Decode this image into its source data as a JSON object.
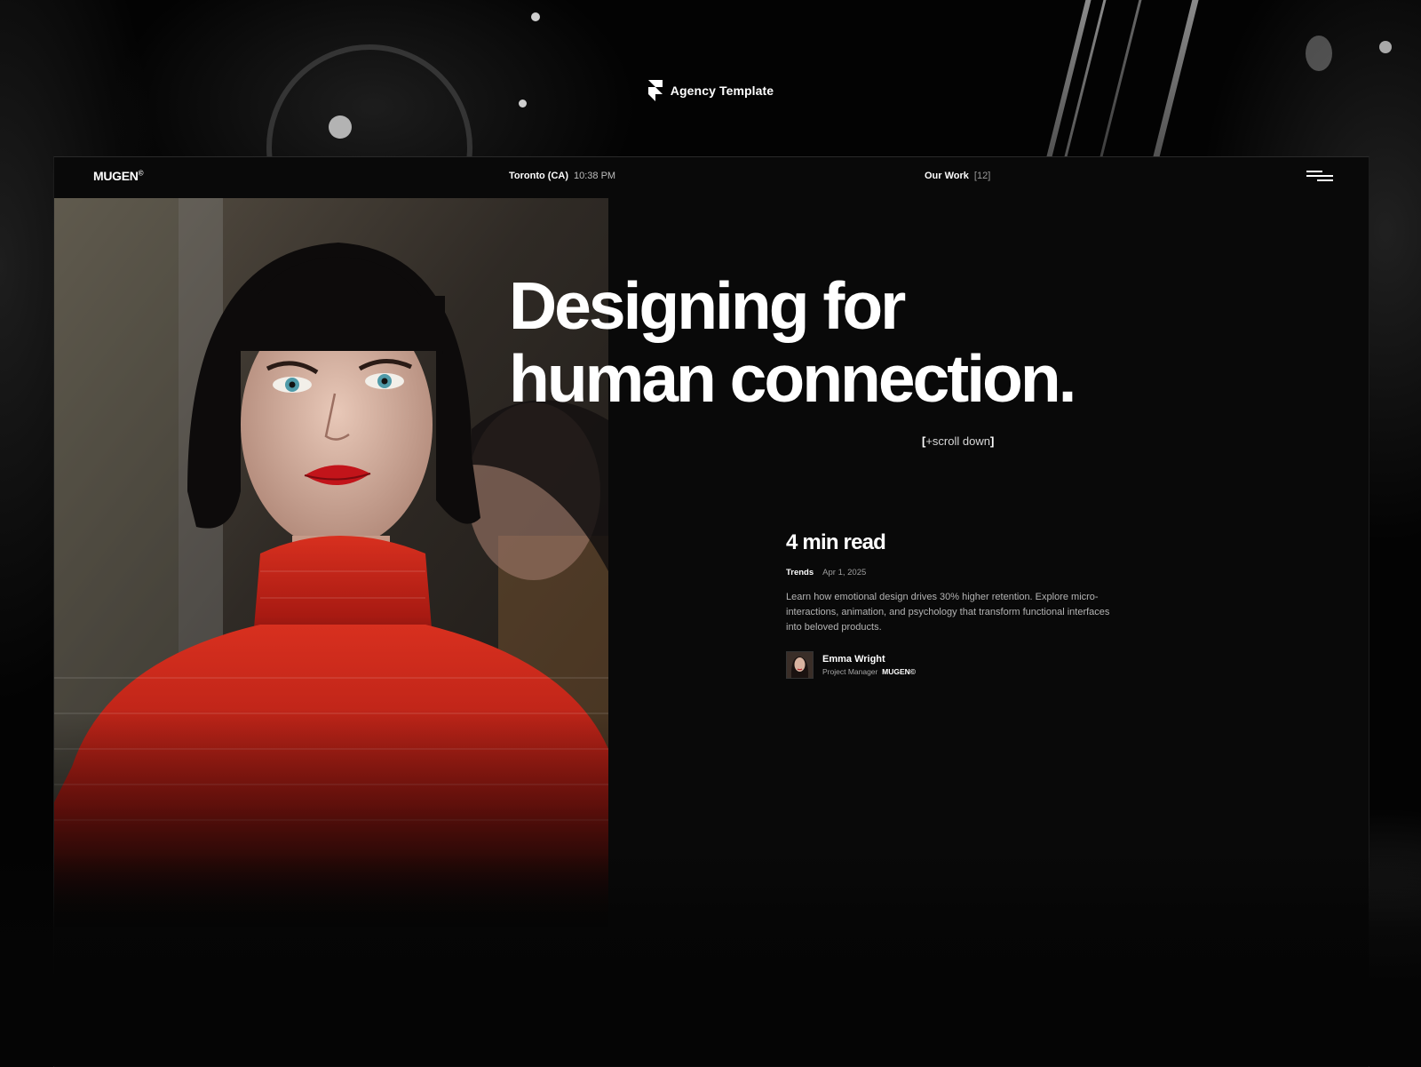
{
  "brand": {
    "title": "Agency Template",
    "logo_icon": "framer-logo-icon"
  },
  "site": {
    "logo": "MUGEN",
    "logo_mark": "©",
    "location": {
      "city": "Toronto (CA)",
      "time": "10:38 PM"
    },
    "nav_work": {
      "label": "Our Work",
      "count": "[12]"
    },
    "menu_icon": "hamburger-menu-icon"
  },
  "hero": {
    "headline_line1": "Designing for",
    "headline_line2": "human connection.",
    "scroll_open": "[",
    "scroll_text": "+scroll down",
    "scroll_close": "]"
  },
  "article": {
    "read_time": "4 min read",
    "tag": "Trends",
    "date": "Apr 1, 2025",
    "excerpt": "Learn how emotional design drives 30% higher retention. Explore micro-interactions, animation, and psychology that transform functional interfaces into beloved products.",
    "author": {
      "name": "Emma Wright",
      "role": "Project Manager",
      "company": "MUGEN©"
    }
  },
  "colors": {
    "background": "#050505",
    "frame": "#090909",
    "text": "#ffffff",
    "muted": "#b4b4b4",
    "accent_red": "#d8231b"
  }
}
